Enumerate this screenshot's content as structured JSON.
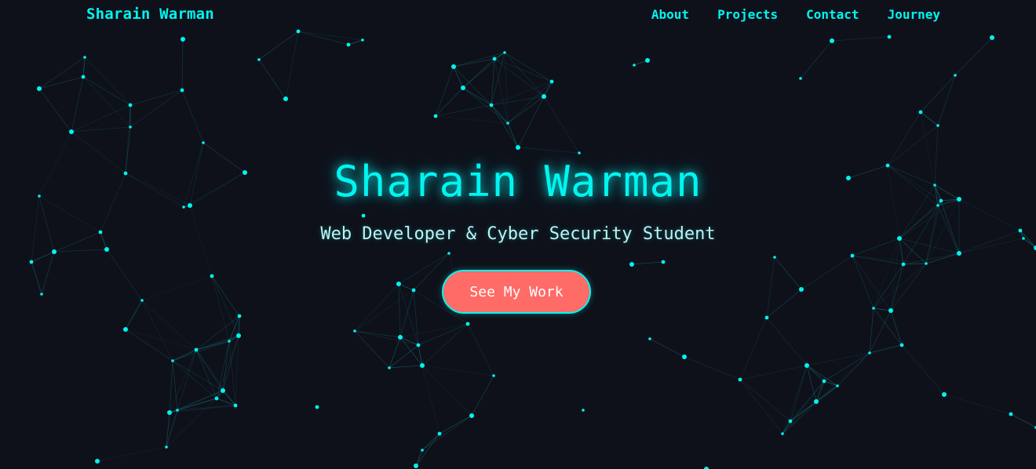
{
  "navbar": {
    "brand": "Sharain Warman",
    "links": [
      "About",
      "Projects",
      "Contact",
      "Journey"
    ]
  },
  "hero": {
    "title": "Sharain Warman",
    "subtitle": "Web Developer & Cyber Security Student",
    "cta_label": "See My Work"
  },
  "colors": {
    "background": "#0e111a",
    "accent": "#00f5f0",
    "button": "#ff6b66",
    "subtitle": "#bff3f3"
  },
  "background_effect": "particle-network"
}
